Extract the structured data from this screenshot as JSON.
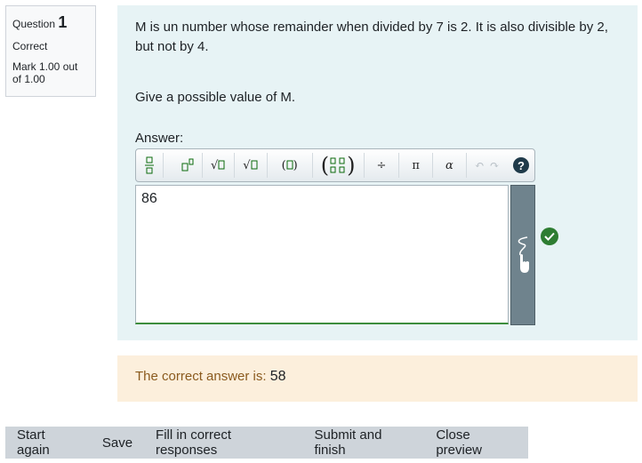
{
  "info": {
    "question_label": "Question",
    "question_number": "1",
    "state": "Correct",
    "mark": "Mark 1.00 out of 1.00"
  },
  "question": {
    "text": "M is un number whose remainder when divided by 7 is 2. It is also divisible by 2, but not by 4.",
    "prompt": "Give a possible value of M.",
    "answer_label": "Answer:",
    "answer_value": "86"
  },
  "toolbar": {
    "buttons": [
      {
        "name": "fraction",
        "glyph": "□⁄□"
      },
      {
        "name": "superscript",
        "glyph": "□ᐞ"
      },
      {
        "name": "square-root",
        "glyph": "√□"
      },
      {
        "name": "nth-root",
        "glyph": "∛□"
      },
      {
        "name": "parentheses",
        "glyph": "(□)"
      },
      {
        "name": "matrix",
        "glyph": "(▯▯)"
      },
      {
        "name": "divide",
        "glyph": "÷"
      },
      {
        "name": "pi",
        "glyph": "π"
      },
      {
        "name": "alpha",
        "glyph": "α"
      },
      {
        "name": "undo",
        "glyph": "↶"
      },
      {
        "name": "redo",
        "glyph": "↷"
      }
    ],
    "help": "?"
  },
  "feedback": {
    "label": "The correct answer is: ",
    "value": "58"
  },
  "actions": [
    "Start again",
    "Save",
    "Fill in correct responses",
    "Submit and finish",
    "Close preview"
  ],
  "colors": {
    "content_bg": "#e7f3f5",
    "feedback_bg": "#fcefdc",
    "correct": "#2e7d32"
  }
}
